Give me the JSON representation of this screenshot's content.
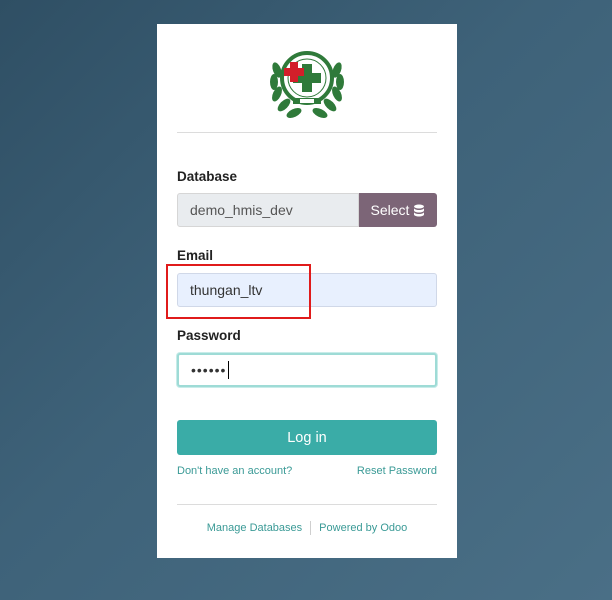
{
  "login": {
    "database_label": "Database",
    "database_value": "demo_hmis_dev",
    "select_label": "Select",
    "email_label": "Email",
    "email_value": "thungan_ltv",
    "password_label": "Password",
    "password_value": "••••••",
    "login_button": "Log in",
    "signup_link": "Don't have an account?",
    "reset_link": "Reset Password"
  },
  "footer": {
    "manage_databases": "Manage Databases",
    "powered_by": "Powered by Odoo"
  },
  "colors": {
    "primary": "#3aaca7",
    "select_button": "#7c6577",
    "highlight": "#e01b1b"
  },
  "logo": {
    "icon": "hospital-emblem-logo"
  }
}
